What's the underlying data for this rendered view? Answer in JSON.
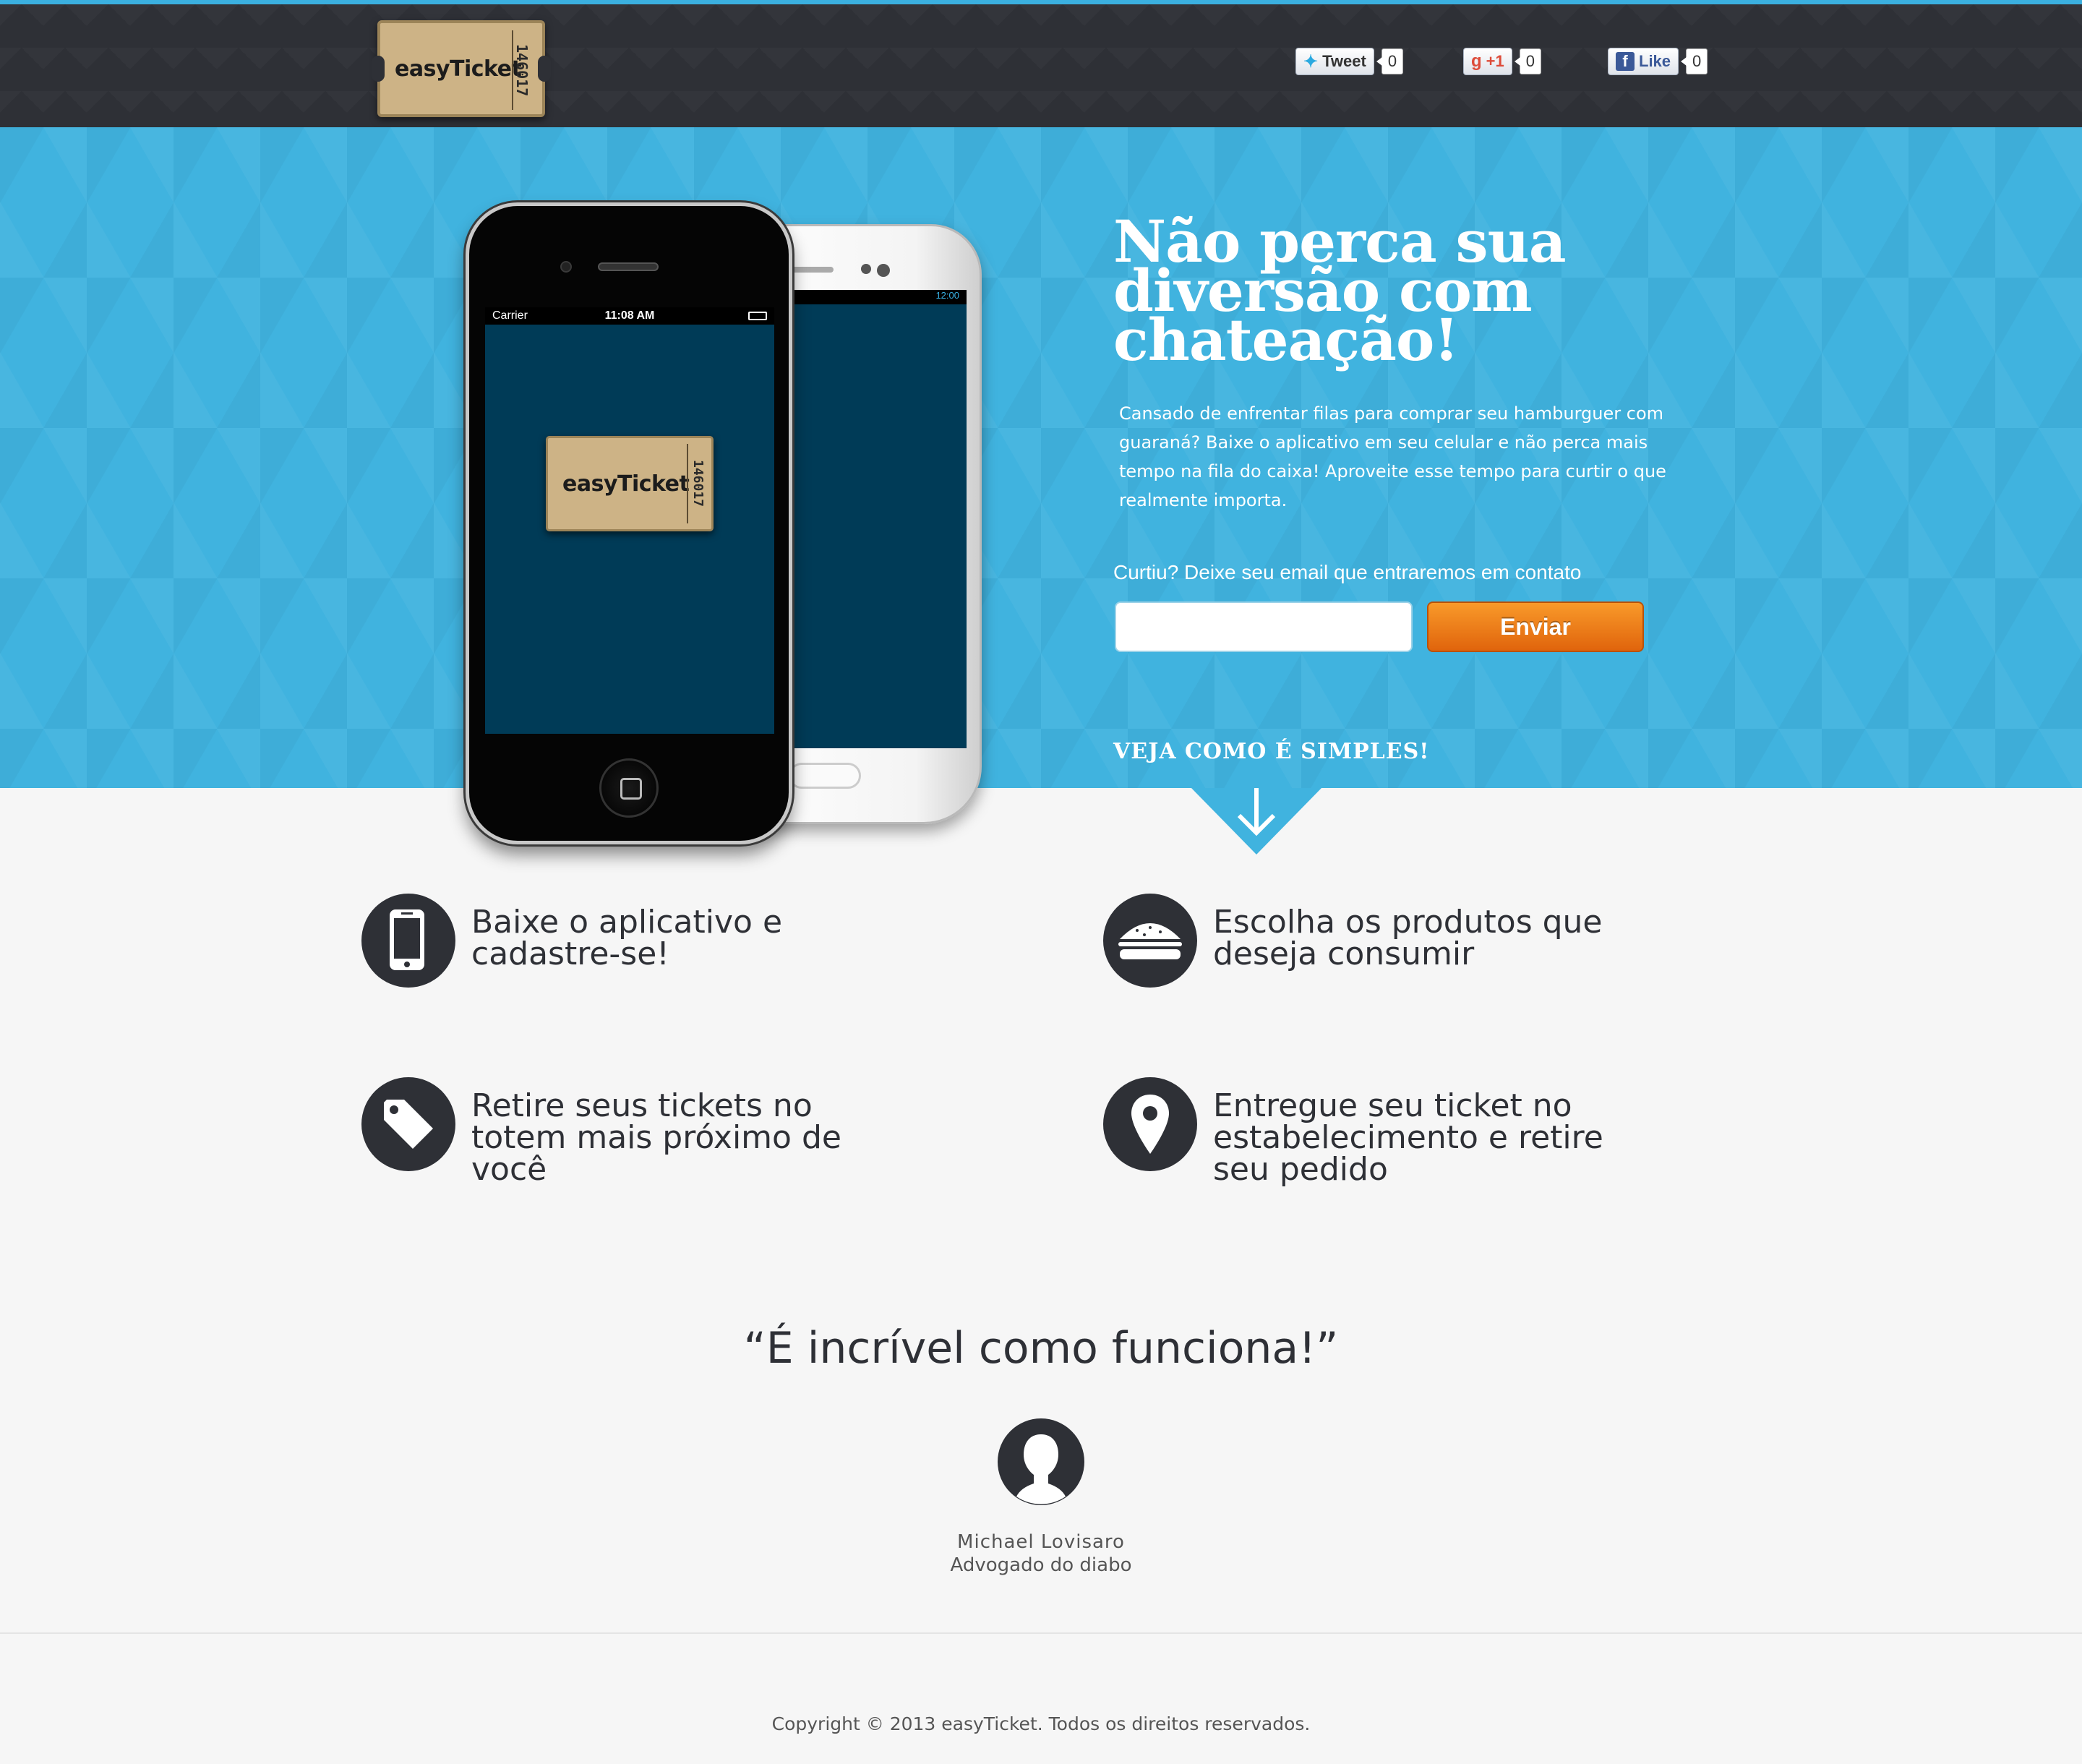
{
  "brand": {
    "logo_text": "easyTicket",
    "ticket_number": "146017"
  },
  "social": {
    "tweet": {
      "label": "Tweet",
      "count": "0"
    },
    "gplus": {
      "label": "+1",
      "count": "0"
    },
    "facebook": {
      "label": "Like",
      "count": "0"
    }
  },
  "hero": {
    "headline": "Não perca sua diversão com chateação!",
    "lead": "Cansado de enfrentar filas para comprar seu hamburguer com guaraná?  Baixe o aplicativo em seu celular e não perca mais tempo na fila do caixa! Aproveite esse tempo para curtir o que realmente importa.",
    "cta_label": "Curtiu? Deixe seu email que entraremos em contato",
    "email_value": "",
    "email_placeholder": "",
    "send_label": "Enviar",
    "scroll_hint": "VEJA COMO É SIMPLES!"
  },
  "phones": {
    "iphone_carrier": "Carrier",
    "iphone_time": "11:08 AM",
    "android_time": "12:00"
  },
  "features": [
    {
      "icon": "smartphone-icon",
      "text": "Baixe o aplicativo e cadastre-se!"
    },
    {
      "icon": "burger-icon",
      "text": "Escolha os produtos que deseja consumir"
    },
    {
      "icon": "tag-icon",
      "text": "Retire seus tickets no totem mais próximo de você"
    },
    {
      "icon": "location-pin-icon",
      "text": "Entregue seu ticket no estabelecimento e retire seu pedido"
    }
  ],
  "testimonial": {
    "quote": "“É incrível como funciona!”",
    "author": "Michael Lovisaro",
    "role": "Advogado do diabo"
  },
  "footer": {
    "copyright": "Copyright © 2013 easyTicket. Todos os direitos reservados."
  },
  "colors": {
    "header_bg": "#2e3036",
    "hero_bg": "#40b3df",
    "accent_orange": "#f0801a",
    "icon_circle": "#2e3036",
    "page_bg": "#f6f6f6"
  }
}
